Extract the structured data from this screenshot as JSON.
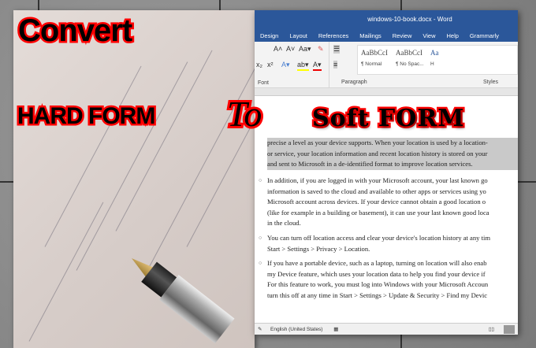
{
  "overlay": {
    "line1": "Convert",
    "line2": "HARD FORM",
    "line3": "To",
    "line4": "Soft FORM"
  },
  "word": {
    "title": "windows-10-book.docx  -  Word",
    "tabs": [
      "Design",
      "Layout",
      "References",
      "Mailings",
      "Review",
      "View",
      "Help",
      "Grammarly"
    ],
    "groups": {
      "font": "Font",
      "paragraph": "Paragraph",
      "styles": "Styles"
    },
    "styles": [
      {
        "sample": "AaBbCcI",
        "name": "¶ Normal"
      },
      {
        "sample": "AaBbCcI",
        "name": "¶ No Spac..."
      },
      {
        "sample": "Aa",
        "name": "H"
      }
    ],
    "paragraphs": [
      {
        "bullet": false,
        "highlight": true,
        "lines": [
          "precise a level as your device supports. When your location is used by a location-",
          "or service, your location information and recent location history is stored on your",
          "and sent to Microsoft in a de-identified format to improve location services."
        ]
      },
      {
        "bullet": true,
        "lines": [
          "In addition, if you are logged in with your Microsoft account, your last known go",
          "information is saved to the cloud and available to other apps or services using yo",
          "Microsoft account across devices. If your device cannot obtain a good location o",
          "(like for example in a building or basement), it can use your last known good loca",
          "in the cloud."
        ]
      },
      {
        "bullet": true,
        "lines": [
          "You can turn off location access and clear your device's location history at any tim",
          "Start > Settings > Privacy > Location."
        ]
      },
      {
        "bullet": true,
        "lines": [
          "If you have a portable device, such as a laptop, turning on location will also enab",
          "my Device feature, which uses your location data to help you find your device if",
          "For this feature to work, you must log into Windows with your Microsoft Accoun",
          "turn this off at any time in Start > Settings > Update & Security > Find my Devic"
        ]
      }
    ],
    "status": {
      "language": "English (United States)"
    }
  }
}
